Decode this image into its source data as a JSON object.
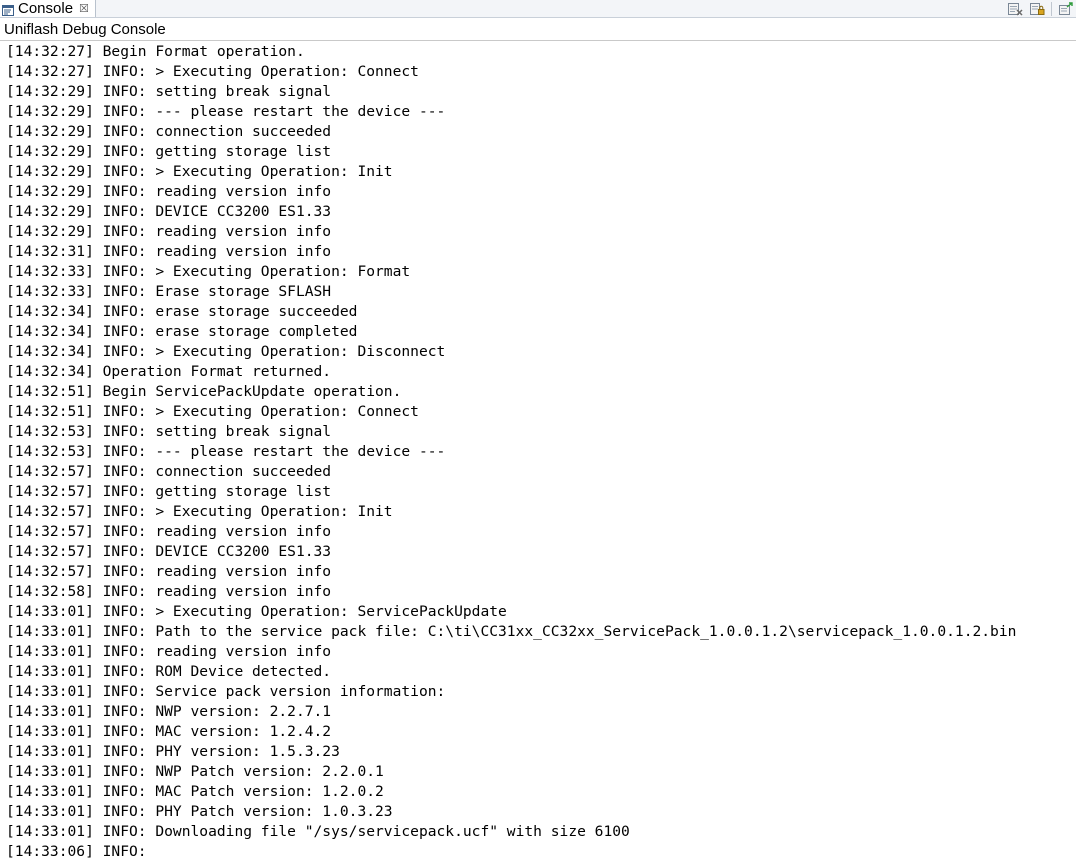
{
  "tab": {
    "label": "Console",
    "close_glyph": "☒"
  },
  "toolbar": {
    "buttons": [
      "clear-console-icon",
      "scroll-lock-icon",
      "pin-console-icon",
      "open-console-icon"
    ]
  },
  "console": {
    "title": "Uniflash Debug Console",
    "lines": [
      "[14:32:27] Begin Format operation.",
      "[14:32:27] INFO: > Executing Operation: Connect",
      "[14:32:29] INFO: setting break signal",
      "[14:32:29] INFO: --- please restart the device ---",
      "[14:32:29] INFO: connection succeeded",
      "[14:32:29] INFO: getting storage list",
      "[14:32:29] INFO: > Executing Operation: Init",
      "[14:32:29] INFO: reading version info",
      "[14:32:29] INFO: DEVICE CC3200 ES1.33",
      "[14:32:29] INFO: reading version info",
      "[14:32:31] INFO: reading version info",
      "[14:32:33] INFO: > Executing Operation: Format",
      "[14:32:33] INFO: Erase storage SFLASH",
      "[14:32:34] INFO: erase storage succeeded",
      "[14:32:34] INFO: erase storage completed",
      "[14:32:34] INFO: > Executing Operation: Disconnect",
      "[14:32:34] Operation Format returned.",
      "[14:32:51] Begin ServicePackUpdate operation.",
      "[14:32:51] INFO: > Executing Operation: Connect",
      "[14:32:53] INFO: setting break signal",
      "[14:32:53] INFO: --- please restart the device ---",
      "[14:32:57] INFO: connection succeeded",
      "[14:32:57] INFO: getting storage list",
      "[14:32:57] INFO: > Executing Operation: Init",
      "[14:32:57] INFO: reading version info",
      "[14:32:57] INFO: DEVICE CC3200 ES1.33",
      "[14:32:57] INFO: reading version info",
      "[14:32:58] INFO: reading version info",
      "[14:33:01] INFO: > Executing Operation: ServicePackUpdate",
      "[14:33:01] INFO: Path to the service pack file: C:\\ti\\CC31xx_CC32xx_ServicePack_1.0.0.1.2\\servicepack_1.0.0.1.2.bin",
      "[14:33:01] INFO: reading version info",
      "[14:33:01] INFO: ROM Device detected.",
      "[14:33:01] INFO: Service pack version information:",
      "[14:33:01] INFO: NWP version: 2.2.7.1",
      "[14:33:01] INFO: MAC version: 1.2.4.2",
      "[14:33:01] INFO: PHY version: 1.5.3.23",
      "[14:33:01] INFO: NWP Patch version: 2.2.0.1",
      "[14:33:01] INFO: MAC Patch version: 1.2.0.2",
      "[14:33:01] INFO: PHY Patch version: 1.0.3.23",
      "[14:33:01] INFO: Downloading file \"/sys/servicepack.ucf\" with size 6100",
      "[14:33:06] INFO:"
    ]
  }
}
